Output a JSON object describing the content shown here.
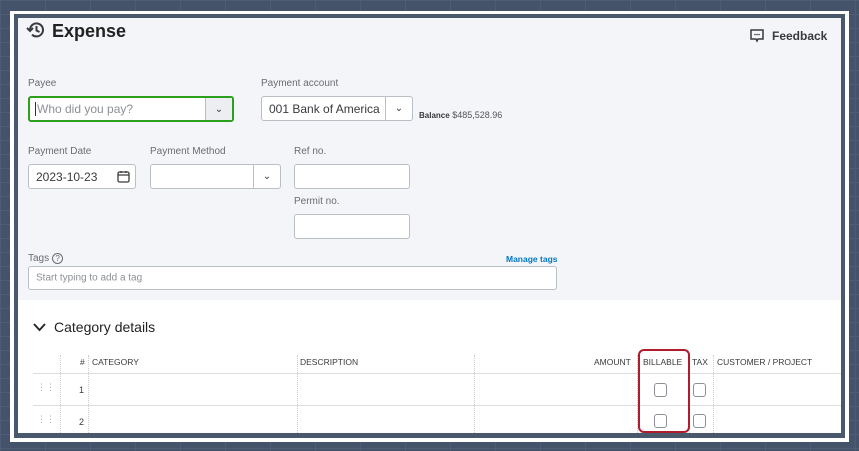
{
  "header": {
    "title": "Expense",
    "feedback_label": "Feedback"
  },
  "form": {
    "payee": {
      "label": "Payee",
      "placeholder": "Who did you pay?"
    },
    "payment_account": {
      "label": "Payment account",
      "value": "001 Bank of America",
      "balance_label": "Balance",
      "balance_value": "$485,528.96"
    },
    "payment_date": {
      "label": "Payment Date",
      "value": "2023-10-23"
    },
    "payment_method": {
      "label": "Payment Method",
      "value": ""
    },
    "ref_no": {
      "label": "Ref no.",
      "value": ""
    },
    "permit_no": {
      "label": "Permit no.",
      "value": ""
    },
    "tags": {
      "label": "Tags",
      "placeholder": "Start typing to add a tag",
      "manage_label": "Manage tags"
    }
  },
  "category_details": {
    "title": "Category details",
    "columns": [
      "#",
      "CATEGORY",
      "DESCRIPTION",
      "AMOUNT",
      "BILLABLE",
      "TAX",
      "CUSTOMER / PROJECT"
    ],
    "rows": [
      {
        "num": "1"
      },
      {
        "num": "2"
      }
    ]
  },
  "colors": {
    "highlight": "#b01c2e",
    "focus": "#2ca01c",
    "link": "#0077c5"
  }
}
